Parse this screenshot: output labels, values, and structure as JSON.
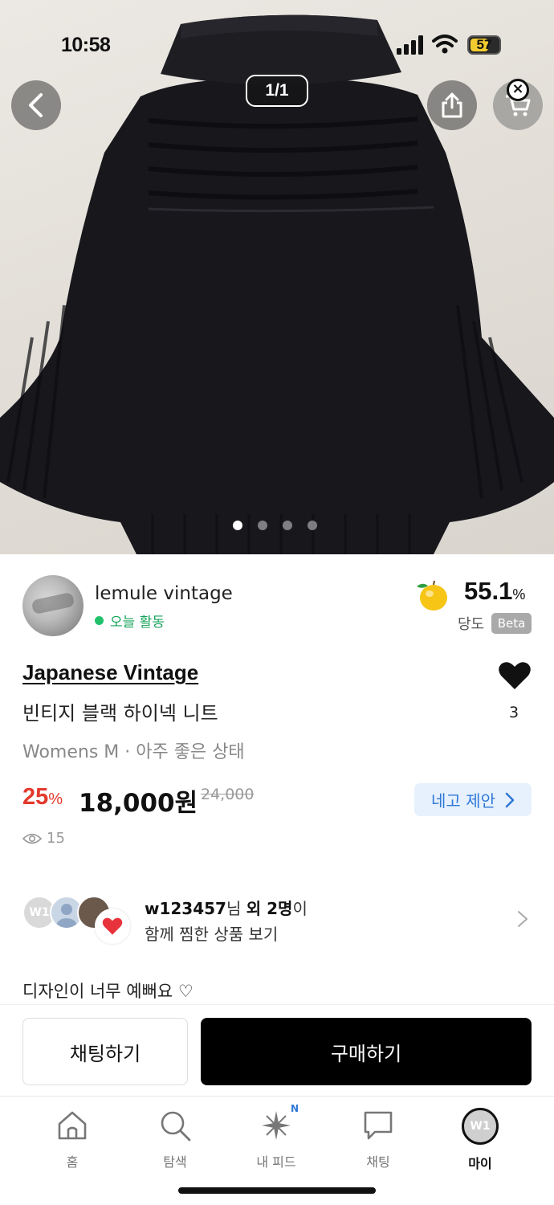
{
  "status_bar": {
    "time": "10:58",
    "battery": "57"
  },
  "gallery": {
    "page_indicator": "1/1",
    "dots_total": 4,
    "dots_active": 1
  },
  "seller": {
    "name": "lemule vintage",
    "activity": "오늘 활동",
    "rating_value": "55.1",
    "rating_unit": "%",
    "rating_label": "당도",
    "rating_badge": "Beta"
  },
  "product": {
    "brand": "Japanese Vintage",
    "title": "빈티지 블랙 하이넥 니트",
    "meta": "Womens M · 아주 좋은 상태",
    "likes": "3",
    "discount_value": "25",
    "discount_unit": "%",
    "price": "18,000원",
    "original_price": "24,000",
    "offer_button": "네고 제안",
    "views": "15",
    "description": "디자인이 너무 예뻐요 ♡"
  },
  "wishers": {
    "avatar_text": "W1",
    "user": "w123457",
    "suffix_1": "님 ",
    "others": "외 2명",
    "suffix_2": "이",
    "line2": "함께 찜한 상품 보기"
  },
  "actions": {
    "chat": "채팅하기",
    "buy": "구매하기"
  },
  "tabs": [
    {
      "label": "홈",
      "icon": "home-icon"
    },
    {
      "label": "탐색",
      "icon": "search-icon"
    },
    {
      "label": "내 피드",
      "icon": "sparkle-icon",
      "badge": "N"
    },
    {
      "label": "채팅",
      "icon": "chat-bubble-icon"
    },
    {
      "label": "마이",
      "icon": "profile-avatar",
      "avatar_text": "W1",
      "active": true
    }
  ],
  "colors": {
    "discount": "#e33a2e",
    "offer_text": "#2e78d6",
    "offer_bg": "#e7f1fd",
    "online": "#22c06a",
    "buy_bg": "#000000"
  }
}
